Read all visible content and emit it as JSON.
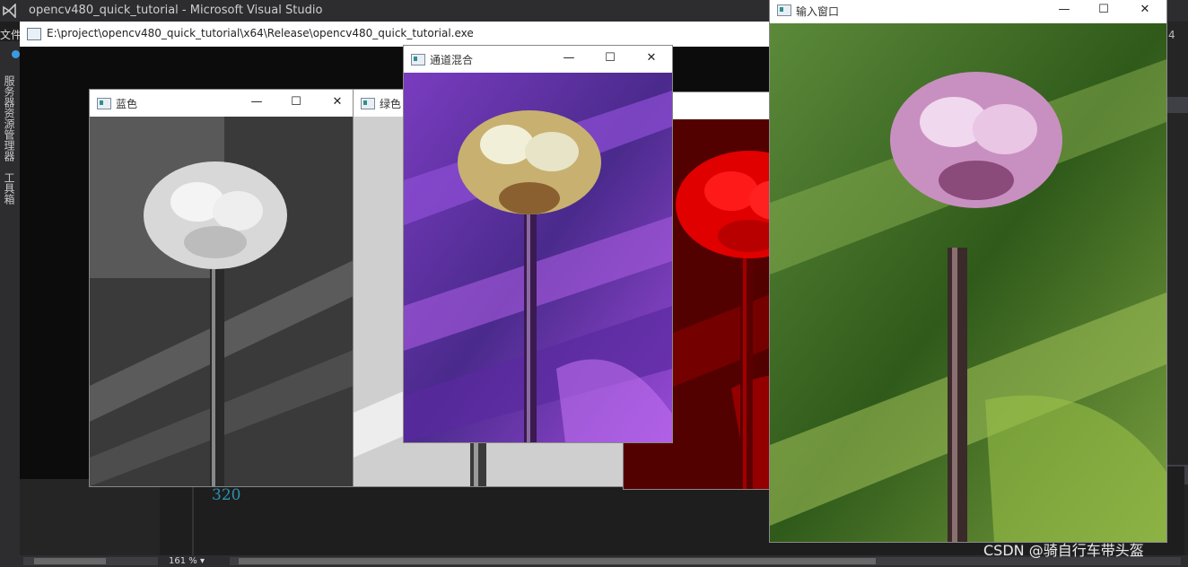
{
  "vs": {
    "title": "opencv480_quick_tutorial - Microsoft Visual Studio",
    "menu_file": "文件",
    "sidebar_tab_1": "服务器资源管理器",
    "sidebar_tab_2": "工具箱",
    "line_number": "320",
    "zoom": "161 %",
    "right_partial": "4"
  },
  "console": {
    "title": "E:\\project\\opencv480_quick_tutorial\\x64\\Release\\opencv480_quick_tutorial.exe"
  },
  "windows": {
    "blue": {
      "title": "蓝色"
    },
    "green": {
      "title": "绿色"
    },
    "merge": {
      "title": "通道混合"
    },
    "red": {
      "title": ""
    },
    "input": {
      "title": "输入窗口"
    }
  },
  "controls": {
    "minimize": "—",
    "maximize": "☐",
    "close": "✕"
  },
  "watermark": "CSDN @骑自行车带头盔",
  "colors": {
    "vs_bg": "#1e1e1e",
    "vs_chrome": "#2d2d30",
    "line_number": "#2b91af",
    "sidebar_accent": "#3c9be0"
  }
}
